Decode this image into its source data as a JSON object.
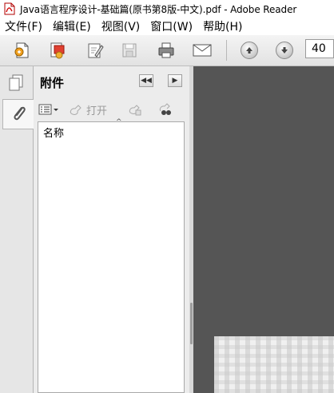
{
  "window": {
    "title": "Java语言程序设计-基础篇(原书第8版-中文).pdf - Adobe Reader"
  },
  "menu": {
    "items": [
      "文件(F)",
      "编辑(E)",
      "视图(V)",
      "窗口(W)",
      "帮助(H)"
    ]
  },
  "toolbar": {
    "icons": [
      "create-pdf-icon",
      "combine-icon",
      "sign-icon",
      "save-icon",
      "print-icon",
      "email-icon",
      "previous-page-icon",
      "next-page-icon"
    ],
    "page_number": "40"
  },
  "attachments_panel": {
    "title": "附件",
    "open_label": "打开",
    "column_header": "名称"
  },
  "colors": {
    "doc_background": "#555555",
    "panel_background": "#ececec"
  }
}
